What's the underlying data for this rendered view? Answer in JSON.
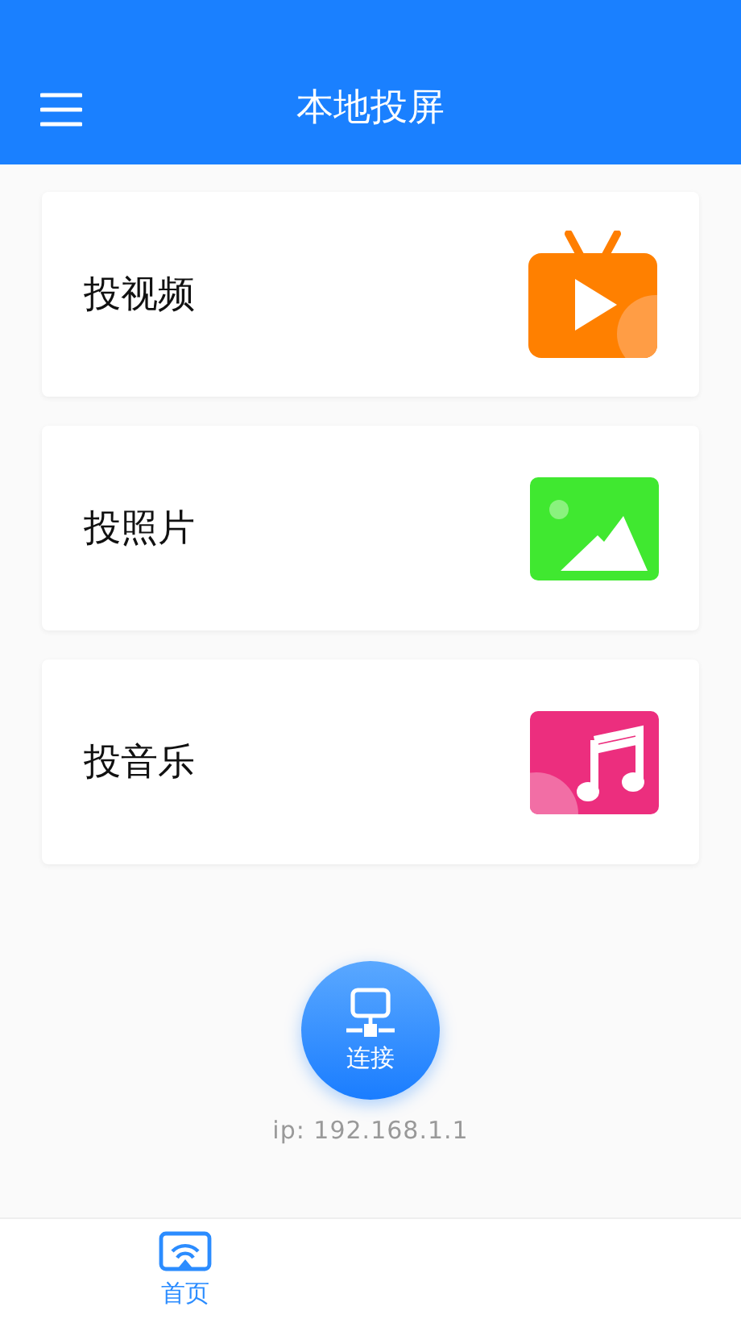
{
  "header": {
    "title": "本地投屏"
  },
  "cast_options": [
    {
      "kind": "video",
      "label": "投视频"
    },
    {
      "kind": "photo",
      "label": "投照片"
    },
    {
      "kind": "music",
      "label": "投音乐"
    }
  ],
  "connect": {
    "label": "连接",
    "ip": "ip: 192.168.1.1"
  },
  "tabs": [
    {
      "label": "首页",
      "selected": true
    }
  ]
}
